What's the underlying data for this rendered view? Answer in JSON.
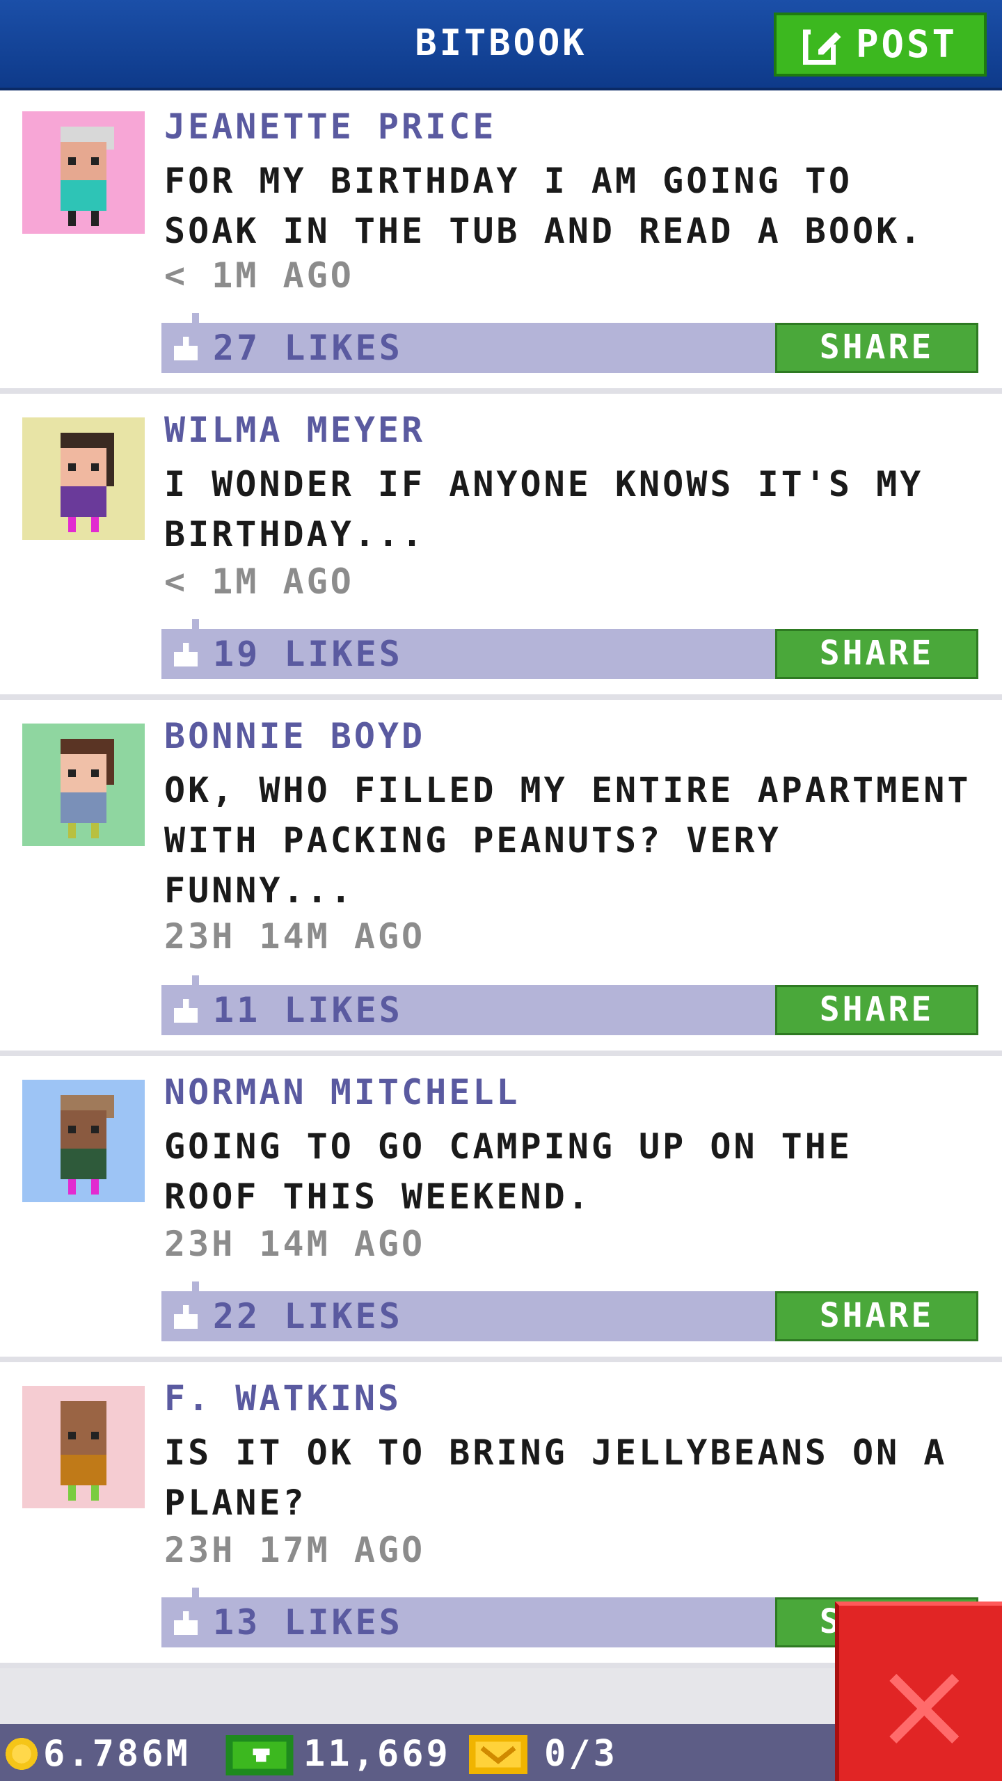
{
  "header": {
    "title": "BITBOOK",
    "post_label": "POST"
  },
  "posts": [
    {
      "author": "JEANETTE PRICE",
      "message": "FOR MY BIRTHDAY I AM GOING TO\nSOAK IN THE TUB AND READ A BOOK.",
      "time": "< 1M AGO",
      "likes": "27 LIKES",
      "share": "SHARE",
      "avatar_bg": "#f7a6d6"
    },
    {
      "author": "WILMA MEYER",
      "message": "I WONDER IF ANYONE KNOWS IT'S MY\nBIRTHDAY...",
      "time": "< 1M AGO",
      "likes": "19 LIKES",
      "share": "SHARE",
      "avatar_bg": "#e8e4a6"
    },
    {
      "author": "BONNIE BOYD",
      "message": "OK, WHO FILLED MY ENTIRE APARTMENT\nWITH PACKING PEANUTS? VERY\nFUNNY...",
      "time": "23H 14M AGO",
      "likes": "11 LIKES",
      "share": "SHARE",
      "avatar_bg": "#8fd6a0"
    },
    {
      "author": "NORMAN MITCHELL",
      "message": "GOING TO GO CAMPING UP ON THE\nROOF THIS WEEKEND.",
      "time": "23H 14M AGO",
      "likes": "22 LIKES",
      "share": "SHARE",
      "avatar_bg": "#9dc4f5"
    },
    {
      "author": "F. WATKINS",
      "message": "IS IT OK TO BRING JELLYBEANS ON A\nPLANE?",
      "time": "23H 17M AGO",
      "likes": "13 LIKES",
      "share": "SHARE",
      "avatar_bg": "#f5ccd2"
    }
  ],
  "footer": {
    "coins": "6.786M",
    "bux": "11,669",
    "tickets": "0/3"
  },
  "icons": {
    "post": "edit-icon",
    "like": "thumb-icon",
    "coin": "coin-icon",
    "bux": "cash-icon",
    "tickets": "ticket-icon",
    "close": "close-icon"
  },
  "colors": {
    "header": "#1b4fa8",
    "accent_green": "#3cb81f",
    "likes_bar": "#b4b4d8",
    "author": "#5a5aa0",
    "close": "#e12525"
  }
}
